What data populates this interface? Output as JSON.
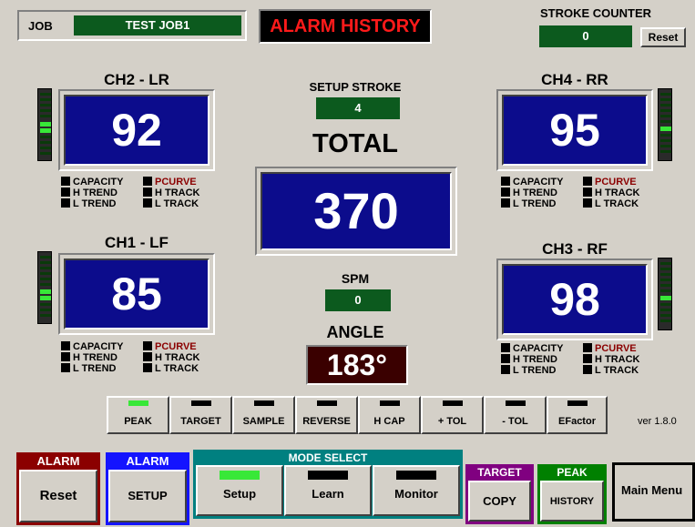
{
  "header": {
    "job_label": "JOB",
    "job_value": "TEST JOB1",
    "alarm_history_label": "ALARM HISTORY",
    "stroke_counter_label": "STROKE COUNTER",
    "stroke_counter_value": "0",
    "reset_label": "Reset"
  },
  "center": {
    "setup_stroke_label": "SETUP STROKE",
    "setup_stroke_value": "4",
    "total_label": "TOTAL",
    "total_value": "370",
    "spm_label": "SPM",
    "spm_value": "0",
    "angle_label": "ANGLE",
    "angle_value": "183°"
  },
  "channels": {
    "lr": {
      "title": "CH2 - LR",
      "value": "92"
    },
    "rr": {
      "title": "CH4 - RR",
      "value": "95"
    },
    "lf": {
      "title": "CH1 - LF",
      "value": "85"
    },
    "rf": {
      "title": "CH3 - RF",
      "value": "98"
    }
  },
  "flags": {
    "capacity": "CAPACITY",
    "pcurve": "PCURVE",
    "h_trend": "H TREND",
    "h_track": "H TRACK",
    "l_trend": "L TREND",
    "l_track": "L TRACK"
  },
  "modes": [
    {
      "label": "PEAK",
      "active": true
    },
    {
      "label": "TARGET",
      "active": false
    },
    {
      "label": "SAMPLE",
      "active": false
    },
    {
      "label": "REVERSE",
      "active": false
    },
    {
      "label": "H CAP",
      "active": false
    },
    {
      "label": "+ TOL",
      "active": false
    },
    {
      "label": "- TOL",
      "active": false
    },
    {
      "label": "EFactor",
      "active": false
    }
  ],
  "version": "ver 1.8.0",
  "footer": {
    "alarm_reset_header": "ALARM",
    "alarm_reset_label": "Reset",
    "alarm_setup_header": "ALARM",
    "alarm_setup_label": "SETUP",
    "mode_select_header": "MODE SELECT",
    "mode_setup": "Setup",
    "mode_learn": "Learn",
    "mode_monitor": "Monitor",
    "target_header": "TARGET",
    "target_label": "COPY",
    "peak_header": "PEAK",
    "peak_label": "HISTORY",
    "main_menu": "Main Menu"
  },
  "colors": {
    "green_value_bg": "#0c5a1e",
    "blue_display_bg": "#0c0c8c",
    "alarm_red": "#ff1a1a",
    "led_on": "#38e838",
    "alarm_reset_header": "#8b0000",
    "alarm_setup_header": "#1414ff",
    "mode_select_header": "#008080",
    "target_header": "#800080",
    "peak_header": "#008000"
  }
}
